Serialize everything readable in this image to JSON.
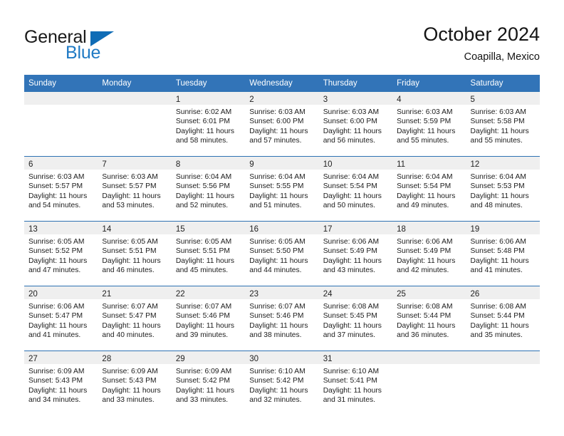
{
  "brand": {
    "name_top": "General",
    "name_bottom": "Blue",
    "triangle_color": "#0f6cb6",
    "blue_text_color": "#1f7ac4"
  },
  "header": {
    "title": "October 2024",
    "subtitle": "Coapilla, Mexico"
  },
  "theme": {
    "header_blue": "#3274b8",
    "row_divider_blue": "#2e72b3",
    "daynum_band_gray": "#efefef"
  },
  "weekdays": [
    "Sunday",
    "Monday",
    "Tuesday",
    "Wednesday",
    "Thursday",
    "Friday",
    "Saturday"
  ],
  "weeks": [
    [
      {
        "day": "",
        "sunrise": "",
        "sunset": "",
        "daylight_1": "",
        "daylight_2": ""
      },
      {
        "day": "",
        "sunrise": "",
        "sunset": "",
        "daylight_1": "",
        "daylight_2": ""
      },
      {
        "day": "1",
        "sunrise": "Sunrise: 6:02 AM",
        "sunset": "Sunset: 6:01 PM",
        "daylight_1": "Daylight: 11 hours",
        "daylight_2": "and 58 minutes."
      },
      {
        "day": "2",
        "sunrise": "Sunrise: 6:03 AM",
        "sunset": "Sunset: 6:00 PM",
        "daylight_1": "Daylight: 11 hours",
        "daylight_2": "and 57 minutes."
      },
      {
        "day": "3",
        "sunrise": "Sunrise: 6:03 AM",
        "sunset": "Sunset: 6:00 PM",
        "daylight_1": "Daylight: 11 hours",
        "daylight_2": "and 56 minutes."
      },
      {
        "day": "4",
        "sunrise": "Sunrise: 6:03 AM",
        "sunset": "Sunset: 5:59 PM",
        "daylight_1": "Daylight: 11 hours",
        "daylight_2": "and 55 minutes."
      },
      {
        "day": "5",
        "sunrise": "Sunrise: 6:03 AM",
        "sunset": "Sunset: 5:58 PM",
        "daylight_1": "Daylight: 11 hours",
        "daylight_2": "and 55 minutes."
      }
    ],
    [
      {
        "day": "6",
        "sunrise": "Sunrise: 6:03 AM",
        "sunset": "Sunset: 5:57 PM",
        "daylight_1": "Daylight: 11 hours",
        "daylight_2": "and 54 minutes."
      },
      {
        "day": "7",
        "sunrise": "Sunrise: 6:03 AM",
        "sunset": "Sunset: 5:57 PM",
        "daylight_1": "Daylight: 11 hours",
        "daylight_2": "and 53 minutes."
      },
      {
        "day": "8",
        "sunrise": "Sunrise: 6:04 AM",
        "sunset": "Sunset: 5:56 PM",
        "daylight_1": "Daylight: 11 hours",
        "daylight_2": "and 52 minutes."
      },
      {
        "day": "9",
        "sunrise": "Sunrise: 6:04 AM",
        "sunset": "Sunset: 5:55 PM",
        "daylight_1": "Daylight: 11 hours",
        "daylight_2": "and 51 minutes."
      },
      {
        "day": "10",
        "sunrise": "Sunrise: 6:04 AM",
        "sunset": "Sunset: 5:54 PM",
        "daylight_1": "Daylight: 11 hours",
        "daylight_2": "and 50 minutes."
      },
      {
        "day": "11",
        "sunrise": "Sunrise: 6:04 AM",
        "sunset": "Sunset: 5:54 PM",
        "daylight_1": "Daylight: 11 hours",
        "daylight_2": "and 49 minutes."
      },
      {
        "day": "12",
        "sunrise": "Sunrise: 6:04 AM",
        "sunset": "Sunset: 5:53 PM",
        "daylight_1": "Daylight: 11 hours",
        "daylight_2": "and 48 minutes."
      }
    ],
    [
      {
        "day": "13",
        "sunrise": "Sunrise: 6:05 AM",
        "sunset": "Sunset: 5:52 PM",
        "daylight_1": "Daylight: 11 hours",
        "daylight_2": "and 47 minutes."
      },
      {
        "day": "14",
        "sunrise": "Sunrise: 6:05 AM",
        "sunset": "Sunset: 5:51 PM",
        "daylight_1": "Daylight: 11 hours",
        "daylight_2": "and 46 minutes."
      },
      {
        "day": "15",
        "sunrise": "Sunrise: 6:05 AM",
        "sunset": "Sunset: 5:51 PM",
        "daylight_1": "Daylight: 11 hours",
        "daylight_2": "and 45 minutes."
      },
      {
        "day": "16",
        "sunrise": "Sunrise: 6:05 AM",
        "sunset": "Sunset: 5:50 PM",
        "daylight_1": "Daylight: 11 hours",
        "daylight_2": "and 44 minutes."
      },
      {
        "day": "17",
        "sunrise": "Sunrise: 6:06 AM",
        "sunset": "Sunset: 5:49 PM",
        "daylight_1": "Daylight: 11 hours",
        "daylight_2": "and 43 minutes."
      },
      {
        "day": "18",
        "sunrise": "Sunrise: 6:06 AM",
        "sunset": "Sunset: 5:49 PM",
        "daylight_1": "Daylight: 11 hours",
        "daylight_2": "and 42 minutes."
      },
      {
        "day": "19",
        "sunrise": "Sunrise: 6:06 AM",
        "sunset": "Sunset: 5:48 PM",
        "daylight_1": "Daylight: 11 hours",
        "daylight_2": "and 41 minutes."
      }
    ],
    [
      {
        "day": "20",
        "sunrise": "Sunrise: 6:06 AM",
        "sunset": "Sunset: 5:47 PM",
        "daylight_1": "Daylight: 11 hours",
        "daylight_2": "and 41 minutes."
      },
      {
        "day": "21",
        "sunrise": "Sunrise: 6:07 AM",
        "sunset": "Sunset: 5:47 PM",
        "daylight_1": "Daylight: 11 hours",
        "daylight_2": "and 40 minutes."
      },
      {
        "day": "22",
        "sunrise": "Sunrise: 6:07 AM",
        "sunset": "Sunset: 5:46 PM",
        "daylight_1": "Daylight: 11 hours",
        "daylight_2": "and 39 minutes."
      },
      {
        "day": "23",
        "sunrise": "Sunrise: 6:07 AM",
        "sunset": "Sunset: 5:46 PM",
        "daylight_1": "Daylight: 11 hours",
        "daylight_2": "and 38 minutes."
      },
      {
        "day": "24",
        "sunrise": "Sunrise: 6:08 AM",
        "sunset": "Sunset: 5:45 PM",
        "daylight_1": "Daylight: 11 hours",
        "daylight_2": "and 37 minutes."
      },
      {
        "day": "25",
        "sunrise": "Sunrise: 6:08 AM",
        "sunset": "Sunset: 5:44 PM",
        "daylight_1": "Daylight: 11 hours",
        "daylight_2": "and 36 minutes."
      },
      {
        "day": "26",
        "sunrise": "Sunrise: 6:08 AM",
        "sunset": "Sunset: 5:44 PM",
        "daylight_1": "Daylight: 11 hours",
        "daylight_2": "and 35 minutes."
      }
    ],
    [
      {
        "day": "27",
        "sunrise": "Sunrise: 6:09 AM",
        "sunset": "Sunset: 5:43 PM",
        "daylight_1": "Daylight: 11 hours",
        "daylight_2": "and 34 minutes."
      },
      {
        "day": "28",
        "sunrise": "Sunrise: 6:09 AM",
        "sunset": "Sunset: 5:43 PM",
        "daylight_1": "Daylight: 11 hours",
        "daylight_2": "and 33 minutes."
      },
      {
        "day": "29",
        "sunrise": "Sunrise: 6:09 AM",
        "sunset": "Sunset: 5:42 PM",
        "daylight_1": "Daylight: 11 hours",
        "daylight_2": "and 33 minutes."
      },
      {
        "day": "30",
        "sunrise": "Sunrise: 6:10 AM",
        "sunset": "Sunset: 5:42 PM",
        "daylight_1": "Daylight: 11 hours",
        "daylight_2": "and 32 minutes."
      },
      {
        "day": "31",
        "sunrise": "Sunrise: 6:10 AM",
        "sunset": "Sunset: 5:41 PM",
        "daylight_1": "Daylight: 11 hours",
        "daylight_2": "and 31 minutes."
      },
      {
        "day": "",
        "sunrise": "",
        "sunset": "",
        "daylight_1": "",
        "daylight_2": ""
      },
      {
        "day": "",
        "sunrise": "",
        "sunset": "",
        "daylight_1": "",
        "daylight_2": ""
      }
    ]
  ]
}
